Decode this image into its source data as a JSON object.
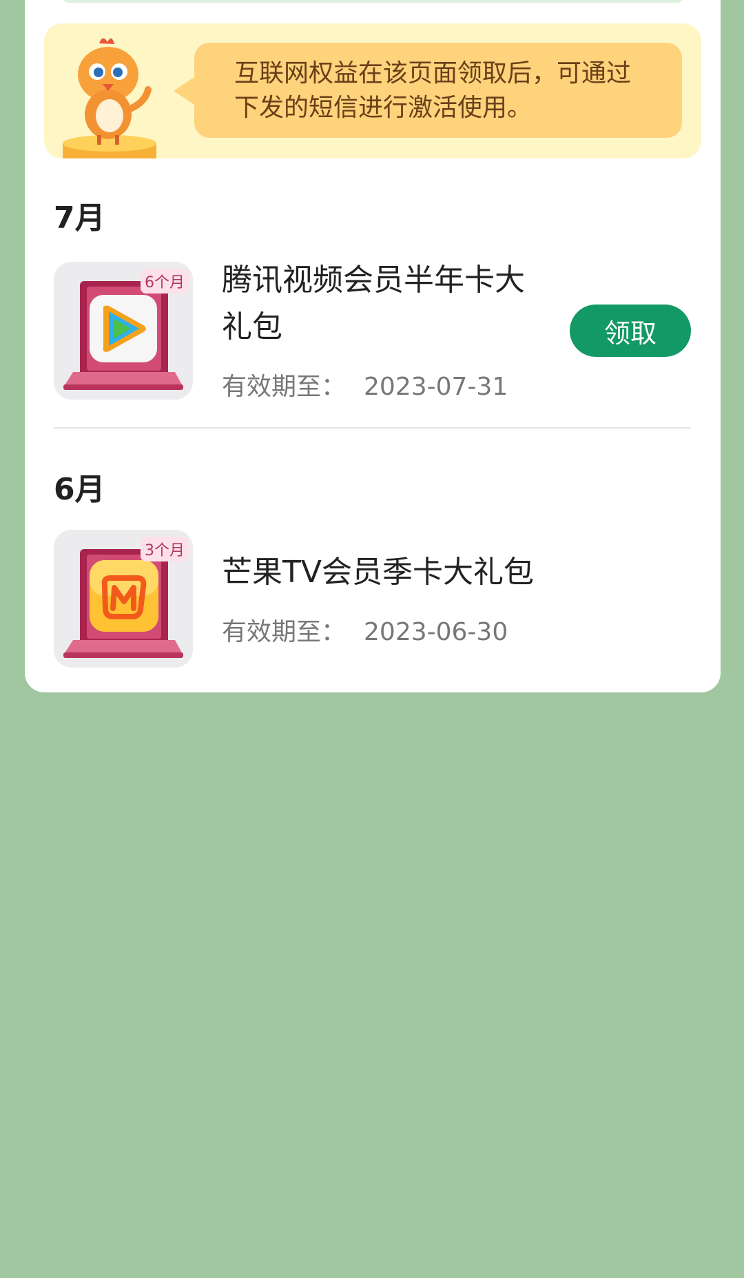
{
  "notice": {
    "text_line1": "互联网权益在该页面领取后，可通过",
    "text_line2": "下发的短信进行激活使用。",
    "mascot_icon": "bird-mascot-icon"
  },
  "groups": [
    {
      "month": "7月",
      "items": [
        {
          "badge": "6个月",
          "title_line1": "腾讯视频会员半年卡大",
          "title_line2": "礼包",
          "expiry_label": "有效期至：",
          "expiry_date": "2023-07-31",
          "button_label": "领取",
          "icon": "tencent-video-icon"
        }
      ]
    },
    {
      "month": "6月",
      "items": [
        {
          "badge": "3个月",
          "title_line1": "芒果TV会员季卡大礼包",
          "expiry_label": "有效期至：",
          "expiry_date": "2023-06-30",
          "icon": "mango-tv-icon"
        }
      ]
    }
  ],
  "colors": {
    "background": "#a0c7a0",
    "claim_button": "#129965",
    "notice_bg": "#fff6c6",
    "bubble": "#ffd27c"
  }
}
